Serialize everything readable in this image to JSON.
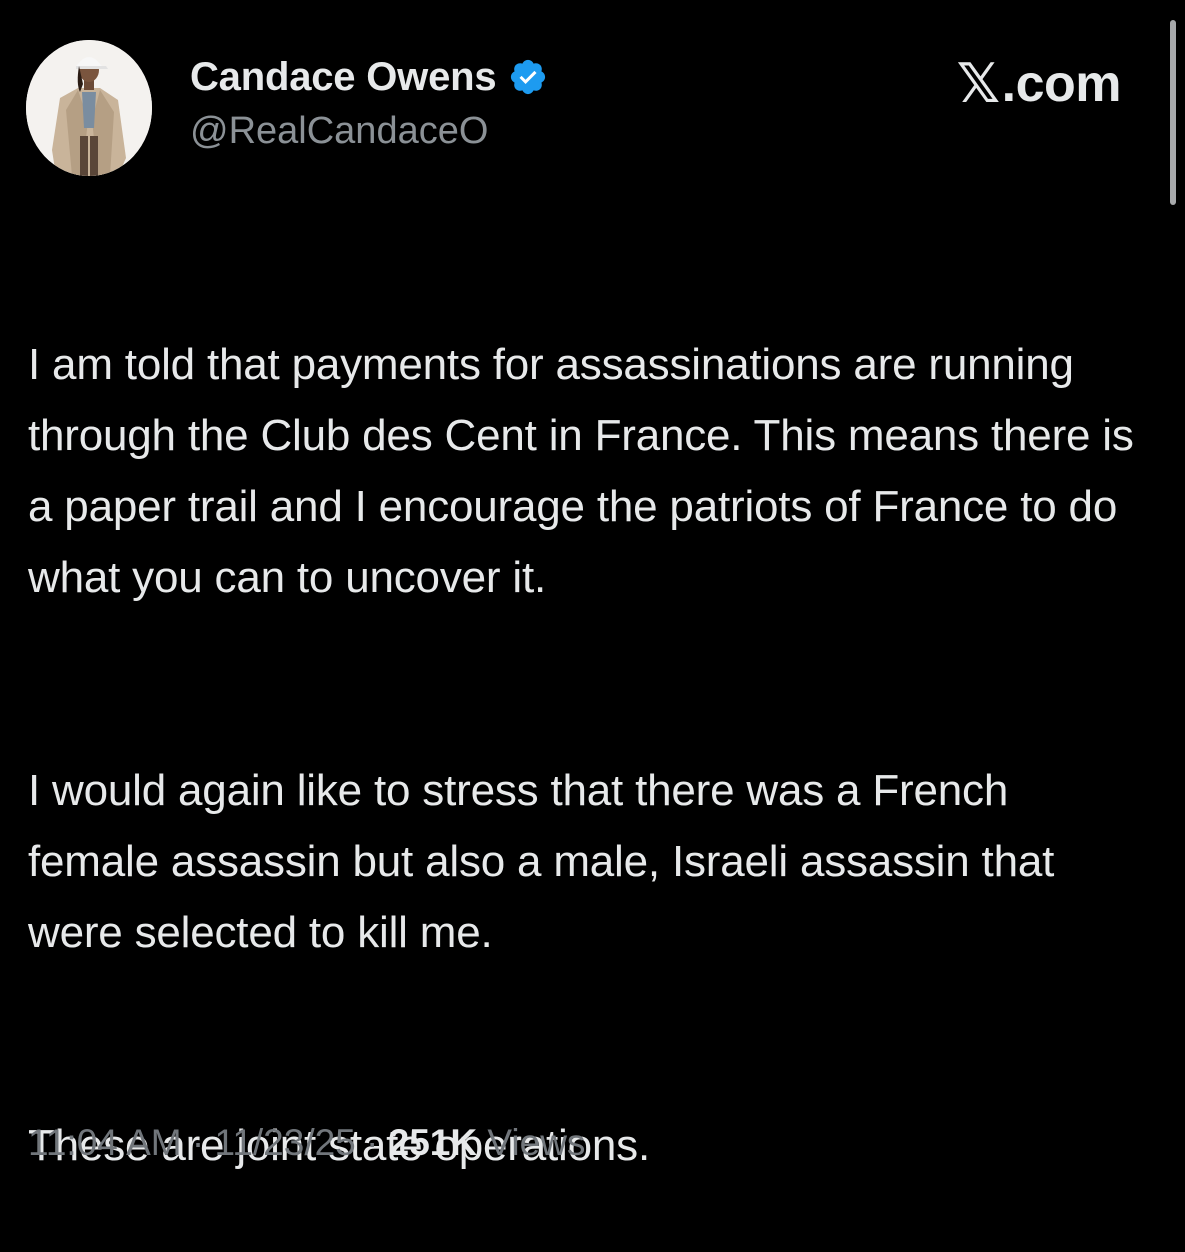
{
  "author": {
    "display_name": "Candace Owens",
    "handle": "@RealCandaceO",
    "verified": true,
    "verified_color": "#1d9bf0"
  },
  "brand": {
    "text": ".com"
  },
  "tweet": {
    "paragraphs": [
      "I am told that payments for assassinations are running through the Club des Cent in France. This means there is a paper trail and I encourage the patriots of France to do what you can to uncover it.",
      "I would again like to stress that there was a French female assassin but also a male, Israeli assassin that were selected to kill me.",
      "These are joint state operations."
    ]
  },
  "meta": {
    "time": "11:04 AM",
    "separator": "·",
    "date": "11/23/25",
    "views_count": "251K",
    "views_label": "Views"
  },
  "colors": {
    "background": "#000000",
    "text_primary": "#e7e9ea",
    "text_secondary": "#71767b"
  }
}
